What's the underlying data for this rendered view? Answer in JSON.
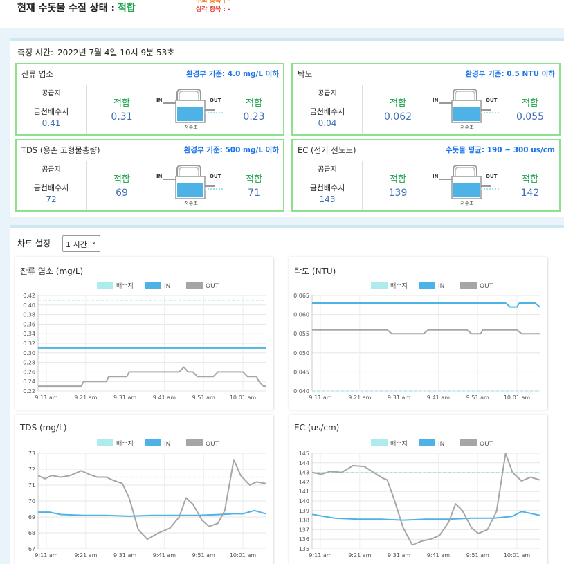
{
  "header": {
    "status_label": "현재 수돗물 수질 상태 :",
    "status_value": "적합",
    "caution_items": "주의 항목 : -",
    "serious_items": "심각 항목 : -"
  },
  "measurement": {
    "label": "측정 시간:",
    "value": "2022년 7월 4일 10시 9분 53초"
  },
  "cards": [
    {
      "title": "잔류 염소",
      "standard": "환경부 기준: 4.0 mg/L 이하",
      "supply_label": "공급지",
      "supply_name": "금천배수지",
      "supply_value": "0.41",
      "in_status": "적합",
      "in_value": "0.31",
      "out_status": "적합",
      "out_value": "0.23",
      "tank_caption": "저수조",
      "in_label": "IN",
      "out_label": "OUT"
    },
    {
      "title": "탁도",
      "standard": "환경부 기준: 0.5 NTU 이하",
      "supply_label": "공급지",
      "supply_name": "금천배수지",
      "supply_value": "0.04",
      "in_status": "적합",
      "in_value": "0.062",
      "out_status": "적합",
      "out_value": "0.055",
      "tank_caption": "저수조",
      "in_label": "IN",
      "out_label": "OUT"
    },
    {
      "title": "TDS (용존 고형물총량)",
      "standard": "환경부 기준: 500 mg/L 이하",
      "supply_label": "공급지",
      "supply_name": "금천배수지",
      "supply_value": "72",
      "in_status": "적합",
      "in_value": "69",
      "out_status": "적합",
      "out_value": "71",
      "tank_caption": "저수조",
      "in_label": "IN",
      "out_label": "OUT"
    },
    {
      "title": "EC (전기 전도도)",
      "standard": "수돗물 평균: 190 ~ 300 us/cm",
      "supply_label": "공급지",
      "supply_name": "금천배수지",
      "supply_value": "143",
      "in_status": "적합",
      "in_value": "139",
      "out_status": "적합",
      "out_value": "142",
      "tank_caption": "저수조",
      "in_label": "IN",
      "out_label": "OUT"
    }
  ],
  "chart_setting": {
    "label": "차트 설정",
    "selected": "1 시간"
  },
  "colors": {
    "reservoir": "#9fe8ea",
    "in": "#4db3e6",
    "out": "#a6a6a6",
    "ok": "#19a34a",
    "card_border": "#8de08d",
    "standard_text": "#1a73e8"
  },
  "chart_data": [
    {
      "type": "line",
      "title": "잔류 염소 (mg/L)",
      "x": [
        "9:11 am",
        "9:21 am",
        "9:31 am",
        "9:41 am",
        "9:51 am",
        "10:01 am"
      ],
      "ylim": [
        0.22,
        0.42
      ],
      "yticks": [
        "0.42",
        "0.40",
        "0.38",
        "0.36",
        "0.34",
        "0.32",
        "0.30",
        "0.28",
        "0.26",
        "0.24",
        "0.22"
      ],
      "series": [
        {
          "name": "배수지",
          "style": "dashed",
          "points": [
            [
              0,
              0.41
            ],
            [
              1,
              0.41
            ]
          ]
        },
        {
          "name": "IN",
          "points": [
            [
              0,
              0.31
            ],
            [
              1,
              0.31
            ]
          ]
        },
        {
          "name": "OUT",
          "points": [
            [
              0,
              0.23
            ],
            [
              0.19,
              0.23
            ],
            [
              0.2,
              0.24
            ],
            [
              0.3,
              0.24
            ],
            [
              0.31,
              0.25
            ],
            [
              0.39,
              0.25
            ],
            [
              0.4,
              0.26
            ],
            [
              0.62,
              0.26
            ],
            [
              0.64,
              0.27
            ],
            [
              0.66,
              0.26
            ],
            [
              0.68,
              0.26
            ],
            [
              0.7,
              0.25
            ],
            [
              0.77,
              0.25
            ],
            [
              0.79,
              0.26
            ],
            [
              0.9,
              0.26
            ],
            [
              0.92,
              0.25
            ],
            [
              0.96,
              0.25
            ],
            [
              0.97,
              0.24
            ],
            [
              0.99,
              0.23
            ],
            [
              1,
              0.23
            ]
          ]
        }
      ]
    },
    {
      "type": "line",
      "title": "탁도 (NTU)",
      "x": [
        "9:11 am",
        "9:21 am",
        "9:31 am",
        "9:41 am",
        "9:51 am",
        "10:01 am"
      ],
      "ylim": [
        0.04,
        0.065
      ],
      "yticks": [
        "0.065",
        "0.060",
        "0.055",
        "0.050",
        "0.045",
        "0.040"
      ],
      "series": [
        {
          "name": "배수지",
          "style": "dashed",
          "points": [
            [
              0,
              0.04
            ],
            [
              1,
              0.04
            ]
          ]
        },
        {
          "name": "IN",
          "points": [
            [
              0,
              0.063
            ],
            [
              0.85,
              0.063
            ],
            [
              0.87,
              0.062
            ],
            [
              0.9,
              0.062
            ],
            [
              0.91,
              0.063
            ],
            [
              0.98,
              0.063
            ],
            [
              1,
              0.062
            ]
          ]
        },
        {
          "name": "OUT",
          "points": [
            [
              0,
              0.056
            ],
            [
              0.33,
              0.056
            ],
            [
              0.35,
              0.055
            ],
            [
              0.49,
              0.055
            ],
            [
              0.51,
              0.056
            ],
            [
              0.68,
              0.056
            ],
            [
              0.7,
              0.055
            ],
            [
              0.74,
              0.055
            ],
            [
              0.75,
              0.056
            ],
            [
              0.9,
              0.056
            ],
            [
              0.92,
              0.055
            ],
            [
              1,
              0.055
            ]
          ]
        }
      ]
    },
    {
      "type": "line",
      "title": "TDS (mg/L)",
      "x": [
        "9:11 am",
        "9:21 am",
        "9:31 am",
        "9:41 am",
        "9:51 am",
        "10:01 am"
      ],
      "ylim": [
        67,
        73
      ],
      "yticks": [
        "73",
        "72",
        "71",
        "70",
        "69",
        "68",
        "67"
      ],
      "series": [
        {
          "name": "배수지",
          "style": "dashed",
          "points": [
            [
              0,
              71.5
            ],
            [
              1,
              71.5
            ]
          ]
        },
        {
          "name": "IN",
          "points": [
            [
              0,
              69.3
            ],
            [
              0.05,
              69.3
            ],
            [
              0.1,
              69.15
            ],
            [
              0.2,
              69.1
            ],
            [
              0.3,
              69.1
            ],
            [
              0.4,
              69.05
            ],
            [
              0.5,
              69.1
            ],
            [
              0.6,
              69.1
            ],
            [
              0.7,
              69.1
            ],
            [
              0.8,
              69.15
            ],
            [
              0.86,
              69.2
            ],
            [
              0.9,
              69.2
            ],
            [
              0.95,
              69.4
            ],
            [
              1,
              69.2
            ]
          ]
        },
        {
          "name": "OUT",
          "points": [
            [
              0,
              71.6
            ],
            [
              0.03,
              71.4
            ],
            [
              0.06,
              71.6
            ],
            [
              0.1,
              71.5
            ],
            [
              0.14,
              71.6
            ],
            [
              0.19,
              71.9
            ],
            [
              0.22,
              71.7
            ],
            [
              0.26,
              71.5
            ],
            [
              0.3,
              71.5
            ],
            [
              0.33,
              71.3
            ],
            [
              0.37,
              71.1
            ],
            [
              0.4,
              70.2
            ],
            [
              0.44,
              68.2
            ],
            [
              0.48,
              67.6
            ],
            [
              0.53,
              68.0
            ],
            [
              0.58,
              68.3
            ],
            [
              0.62,
              69.0
            ],
            [
              0.65,
              70.2
            ],
            [
              0.68,
              69.8
            ],
            [
              0.72,
              68.8
            ],
            [
              0.75,
              68.4
            ],
            [
              0.79,
              68.6
            ],
            [
              0.82,
              69.4
            ],
            [
              0.86,
              72.6
            ],
            [
              0.89,
              71.6
            ],
            [
              0.93,
              71.0
            ],
            [
              0.96,
              71.2
            ],
            [
              1,
              71.1
            ]
          ]
        }
      ]
    },
    {
      "type": "line",
      "title": "EC (us/cm)",
      "x": [
        "9:11 am",
        "9:21 am",
        "9:31 am",
        "9:41 am",
        "9:51 am",
        "10:01 am"
      ],
      "ylim": [
        135,
        145
      ],
      "yticks": [
        "145",
        "144",
        "143",
        "142",
        "141",
        "140",
        "139",
        "138",
        "137",
        "136",
        "135"
      ],
      "series": [
        {
          "name": "배수지",
          "style": "dashed",
          "points": [
            [
              0,
              143
            ],
            [
              1,
              143
            ]
          ]
        },
        {
          "name": "IN",
          "points": [
            [
              0,
              138.6
            ],
            [
              0.05,
              138.4
            ],
            [
              0.1,
              138.2
            ],
            [
              0.2,
              138.1
            ],
            [
              0.3,
              138.1
            ],
            [
              0.4,
              138.0
            ],
            [
              0.5,
              138.1
            ],
            [
              0.6,
              138.1
            ],
            [
              0.7,
              138.2
            ],
            [
              0.8,
              138.2
            ],
            [
              0.88,
              138.4
            ],
            [
              0.92,
              138.9
            ],
            [
              0.96,
              138.7
            ],
            [
              1,
              138.5
            ]
          ]
        },
        {
          "name": "OUT",
          "points": [
            [
              0,
              143.0
            ],
            [
              0.04,
              142.8
            ],
            [
              0.08,
              143.1
            ],
            [
              0.13,
              143.0
            ],
            [
              0.18,
              143.7
            ],
            [
              0.23,
              143.6
            ],
            [
              0.27,
              143.0
            ],
            [
              0.31,
              142.4
            ],
            [
              0.33,
              142.2
            ],
            [
              0.36,
              140.2
            ],
            [
              0.4,
              137.2
            ],
            [
              0.44,
              135.4
            ],
            [
              0.48,
              135.8
            ],
            [
              0.52,
              136.0
            ],
            [
              0.56,
              136.4
            ],
            [
              0.6,
              137.8
            ],
            [
              0.63,
              139.7
            ],
            [
              0.66,
              139.0
            ],
            [
              0.7,
              137.2
            ],
            [
              0.73,
              136.6
            ],
            [
              0.77,
              137.0
            ],
            [
              0.81,
              138.9
            ],
            [
              0.85,
              145.0
            ],
            [
              0.88,
              143.0
            ],
            [
              0.92,
              142.1
            ],
            [
              0.96,
              142.5
            ],
            [
              1,
              142.2
            ]
          ]
        }
      ]
    }
  ]
}
